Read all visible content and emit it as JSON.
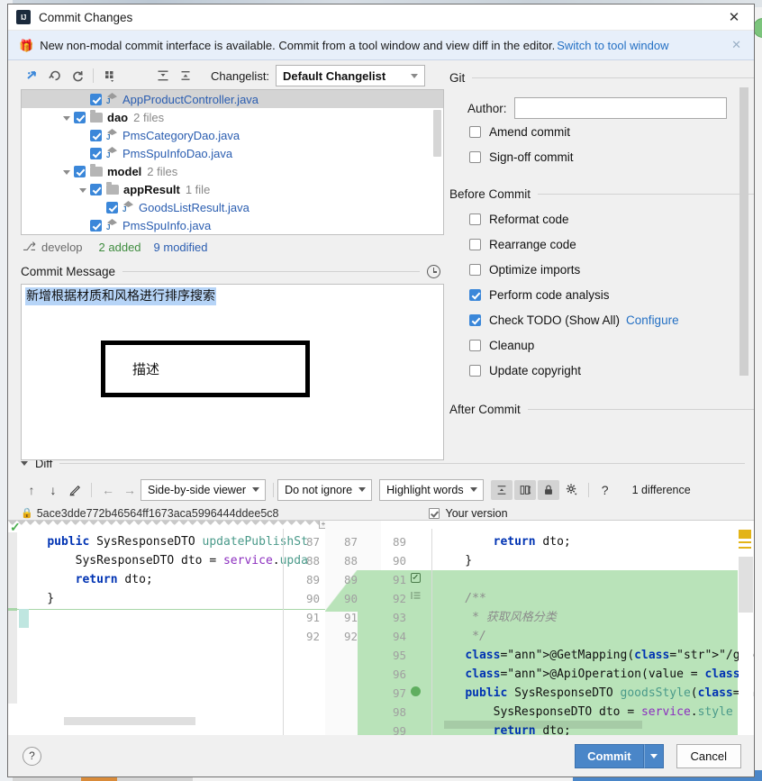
{
  "window": {
    "title": "Commit Changes",
    "logo": "intellij-idea-logo",
    "close_label": "✕"
  },
  "banner": {
    "icon": "gift-icon",
    "text": "New non-modal commit interface is available. Commit from a tool window and view diff in the editor.",
    "link": "Switch to tool window",
    "close": "✕"
  },
  "changelist_toolbar": {
    "buttons": [
      {
        "name": "move-to-another-changelist-icon",
        "glyph": "⤴"
      },
      {
        "name": "revert-icon",
        "glyph": "↶"
      },
      {
        "name": "refresh-icon",
        "glyph": "↻"
      },
      {
        "name": "group-by-icon",
        "glyph": "∷"
      },
      {
        "name": "expand-all-icon",
        "glyph": "⬍"
      },
      {
        "name": "collapse-all-icon",
        "glyph": "⬌"
      }
    ],
    "label": "Changelist:",
    "selected": "Default Changelist"
  },
  "file_tree": {
    "rows": [
      {
        "indent": 3,
        "twisty": false,
        "checked": true,
        "icon": "java-file-icon",
        "name": "AppProductController.java",
        "count": "",
        "selected": true,
        "kind": "file"
      },
      {
        "indent": 2,
        "twisty": true,
        "checked": true,
        "icon": "folder-icon",
        "name": "dao",
        "count": "2 files",
        "selected": false,
        "kind": "dir"
      },
      {
        "indent": 3,
        "twisty": false,
        "checked": true,
        "icon": "java-file-icon",
        "name": "PmsCategoryDao.java",
        "count": "",
        "selected": false,
        "kind": "file"
      },
      {
        "indent": 3,
        "twisty": false,
        "checked": true,
        "icon": "java-file-icon",
        "name": "PmsSpuInfoDao.java",
        "count": "",
        "selected": false,
        "kind": "file"
      },
      {
        "indent": 2,
        "twisty": true,
        "checked": true,
        "icon": "folder-icon",
        "name": "model",
        "count": "2 files",
        "selected": false,
        "kind": "dir"
      },
      {
        "indent": 3,
        "twisty": true,
        "checked": true,
        "icon": "folder-icon",
        "name": "appResult",
        "count": "1 file",
        "selected": false,
        "kind": "dir"
      },
      {
        "indent": 4,
        "twisty": false,
        "checked": true,
        "icon": "java-file-icon",
        "name": "GoodsListResult.java",
        "count": "",
        "selected": false,
        "kind": "file"
      },
      {
        "indent": 3,
        "twisty": false,
        "checked": true,
        "icon": "java-file-icon",
        "name": "PmsSpuInfo.java",
        "count": "",
        "selected": false,
        "kind": "file"
      }
    ],
    "status": {
      "branch_icon": "git-branch-icon",
      "branch": "develop",
      "added": "2 added",
      "modified": "9 modified"
    }
  },
  "commit_message": {
    "title": "Commit Message",
    "history_icon": "clock-icon",
    "text": "新增根据材质和风格进行排序搜索",
    "annotation": "描述"
  },
  "options": {
    "git": {
      "title": "Git",
      "author_label": "Author:",
      "author_value": "",
      "author_placeholder": "",
      "checkboxes": [
        {
          "label": "Amend commit",
          "checked": false
        },
        {
          "label": "Sign-off commit",
          "checked": false
        }
      ]
    },
    "before_commit": {
      "title": "Before Commit",
      "checkboxes": [
        {
          "label": "Reformat code",
          "checked": false,
          "link": ""
        },
        {
          "label": "Rearrange code",
          "checked": false,
          "link": ""
        },
        {
          "label": "Optimize imports",
          "checked": false,
          "link": ""
        },
        {
          "label": "Perform code analysis",
          "checked": true,
          "link": ""
        },
        {
          "label": "Check TODO (Show All)",
          "checked": true,
          "link": "Configure"
        },
        {
          "label": "Cleanup",
          "checked": false,
          "link": ""
        },
        {
          "label": "Update copyright",
          "checked": false,
          "link": ""
        }
      ]
    },
    "after_commit": {
      "title": "After Commit"
    }
  },
  "diff": {
    "title": "Diff",
    "nav": [
      {
        "name": "previous-difference-icon",
        "glyph": "↑"
      },
      {
        "name": "next-difference-icon",
        "glyph": "↓"
      },
      {
        "name": "edit-source-icon",
        "glyph": "✎"
      },
      {
        "name": "accept-left-icon",
        "glyph": "←"
      },
      {
        "name": "accept-right-icon",
        "glyph": "→"
      }
    ],
    "viewer_mode": "Side-by-side viewer",
    "ignore_mode": "Do not ignore",
    "highlight_mode": "Highlight words",
    "flat_buttons": [
      {
        "name": "collapse-unchanged-icon",
        "glyph": "⬌"
      },
      {
        "name": "synchronize-scroll-icon",
        "glyph": "↕"
      },
      {
        "name": "read-only-lock-icon",
        "glyph": "🔒"
      },
      {
        "name": "diff-settings-gear-icon",
        "glyph": "⚙"
      }
    ],
    "help_glyph": "?",
    "difference_count": "1 difference",
    "revision_lock_icon": "lock-icon",
    "revision_hash": "5ace3dde772b46564ff1673aca5996444ddee5c8",
    "your_version_label": "Your version",
    "your_version_checked": true,
    "left_pane": {
      "line_numbers": [
        "87",
        "88",
        "89",
        "90",
        "91",
        "92"
      ],
      "lines": [
        "    public SysResponseDTO updatePublishSt",
        "        SysResponseDTO dto = service.upda",
        "        return dto;",
        "    }",
        "}",
        ""
      ]
    },
    "right_pane": {
      "line_numbers": [
        "89",
        "90",
        "91",
        "92",
        "93",
        "94",
        "95",
        "96",
        "97",
        "98",
        "99"
      ],
      "lines": [
        "        return dto;",
        "    }",
        "",
        "    /**",
        "     * 获取风格分类",
        "     */",
        "    @GetMapping(\"/goods/style\")",
        "    @ApiOperation(value = \"获取风格分类\")",
        "    public SysResponseDTO goodsStyle(@Requ",
        "        SysResponseDTO dto = service.style",
        "        return dto;"
      ],
      "gutter_marks": [
        {
          "line": "91",
          "icon": "accept-change-checkbox-icon"
        },
        {
          "line": "92",
          "icon": "fold-block-icon"
        },
        {
          "line": "97",
          "icon": "web-endpoint-icon"
        }
      ]
    },
    "mid_line_numbers": [
      "87",
      "88",
      "89",
      "90",
      "91",
      "92"
    ]
  },
  "footer": {
    "help_glyph": "?",
    "commit_label": "Commit",
    "commit_dropdown_icon": "chevron-down-icon",
    "cancel_label": "Cancel"
  },
  "colors": {
    "accent": "#4a86c8",
    "link": "#2470c4",
    "checked": "#3b87d9",
    "added_bg": "#b9e3b9",
    "selection": "#b6d4f7",
    "added_text": "#3f8c3f",
    "modified_text": "#2a5db0"
  }
}
